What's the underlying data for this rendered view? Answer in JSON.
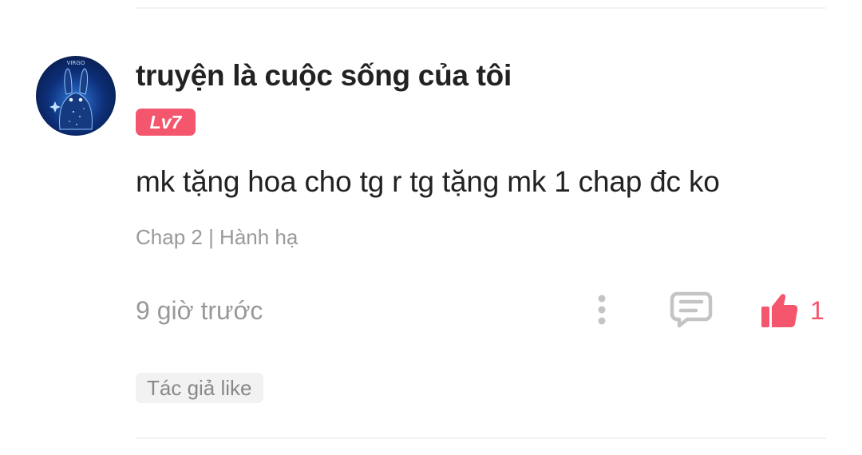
{
  "comment": {
    "username": "truyện là cuộc sống của tôi",
    "level": "Lv7",
    "avatar": {
      "icon": "virgo-bunny-avatar",
      "label": "VIRGO"
    },
    "text": "mk tặng hoa cho tg r tg tặng mk 1 chap đc ko",
    "chapter": "Chap 2 | Hành hạ",
    "time": "9 giờ trước",
    "actions": {
      "more_icon": "more-vertical-icon",
      "reply_icon": "comment-icon",
      "like_icon": "thumbs-up-icon",
      "like_count": "1"
    },
    "author_like_tag": "Tác giả like"
  },
  "colors": {
    "accent": "#f4566e",
    "text_primary": "#222222",
    "text_secondary": "#999999",
    "icon_gray": "#c4c4c4",
    "tag_background": "#f2f2f2"
  }
}
